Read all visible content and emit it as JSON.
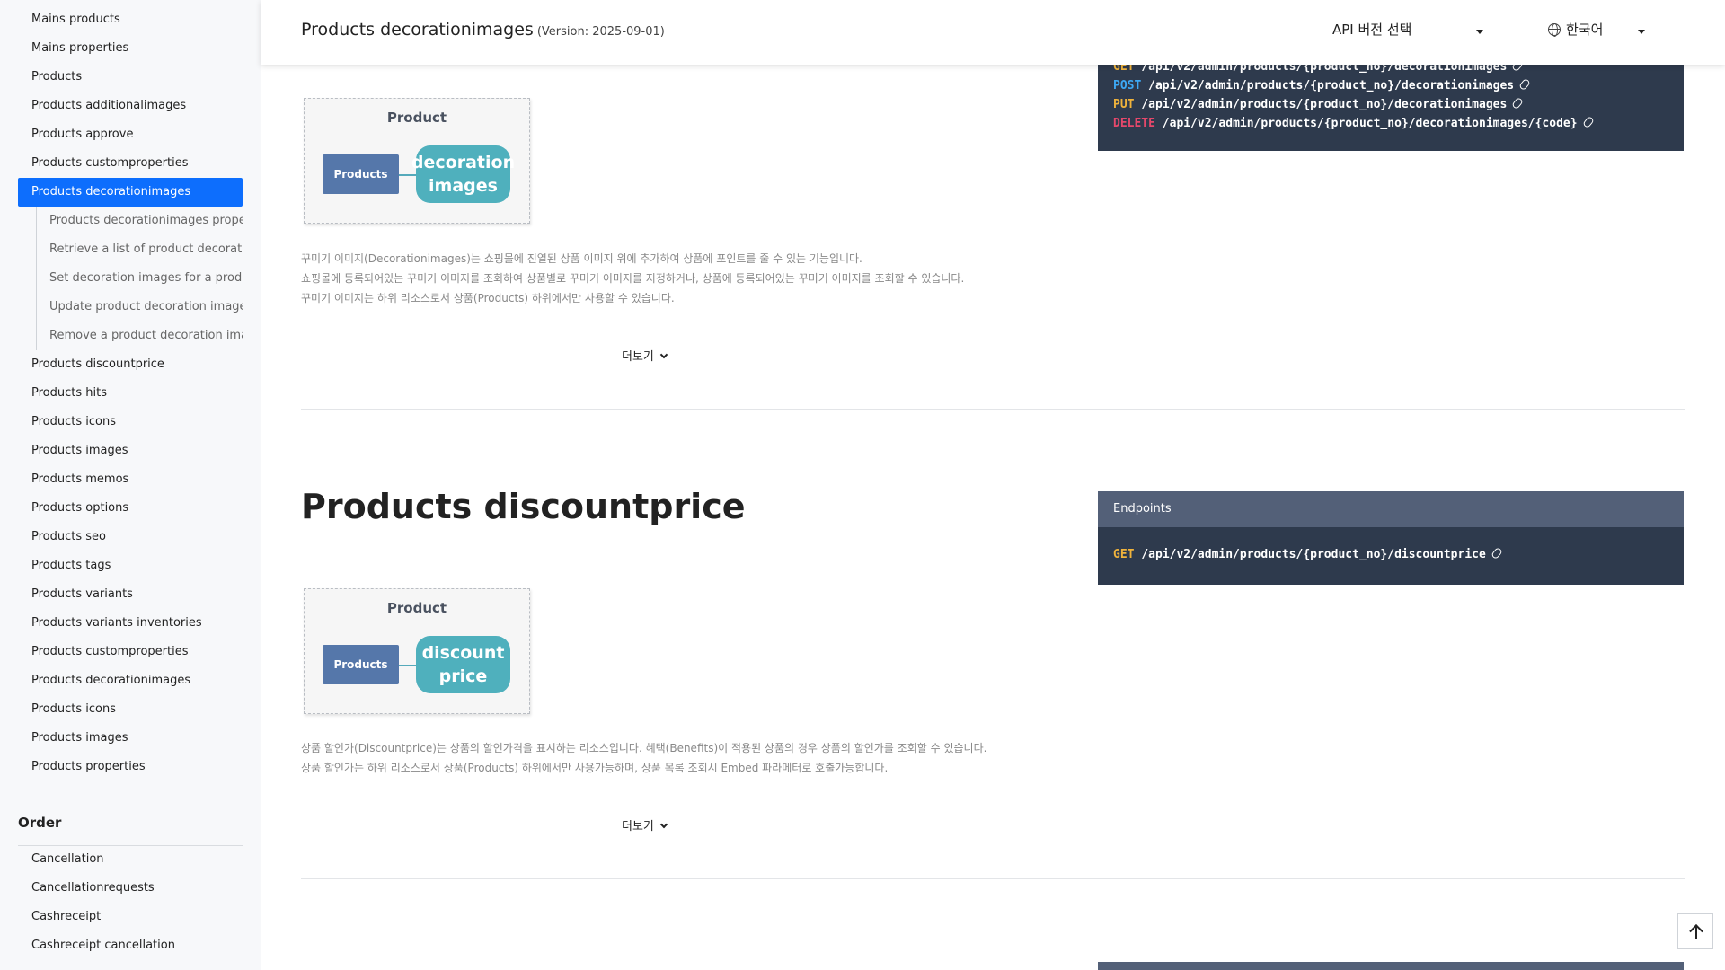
{
  "header": {
    "title": "Products decorationimages",
    "version": "(Version: 2025-09-01)",
    "api_select_label": "API 버전 선택",
    "language_label": "한국어"
  },
  "sidebar": {
    "items_top": [
      {
        "label": "Mains products"
      },
      {
        "label": "Mains properties"
      },
      {
        "label": "Products"
      },
      {
        "label": "Products additionalimages"
      },
      {
        "label": "Products approve"
      },
      {
        "label": "Products customproperties"
      },
      {
        "label": "Products decorationimages",
        "active": true
      }
    ],
    "sub_items": [
      {
        "label": "Products decorationimages property"
      },
      {
        "label": "Retrieve a list of product decoration"
      },
      {
        "label": "Set decoration images for a product"
      },
      {
        "label": "Update product decoration images"
      },
      {
        "label": "Remove a product decoration image"
      }
    ],
    "items_bottom": [
      {
        "label": "Products discountprice"
      },
      {
        "label": "Products hits"
      },
      {
        "label": "Products icons"
      },
      {
        "label": "Products images"
      },
      {
        "label": "Products memos"
      },
      {
        "label": "Products options"
      },
      {
        "label": "Products seo"
      },
      {
        "label": "Products tags"
      },
      {
        "label": "Products variants"
      },
      {
        "label": "Products variants inventories"
      },
      {
        "label": "Products customproperties"
      },
      {
        "label": "Products decorationimages"
      },
      {
        "label": "Products icons"
      },
      {
        "label": "Products images"
      },
      {
        "label": "Products properties"
      }
    ],
    "section_order": "Order",
    "order_items": [
      {
        "label": "Cancellation"
      },
      {
        "label": "Cancellationrequests"
      },
      {
        "label": "Cashreceipt"
      },
      {
        "label": "Cashreceipt cancellation"
      }
    ]
  },
  "section1": {
    "endpoints": [
      {
        "method": "GET",
        "path": "/api/v2/admin/products/{product_no}/decorationimages"
      },
      {
        "method": "POST",
        "path": "/api/v2/admin/products/{product_no}/decorationimages"
      },
      {
        "method": "PUT",
        "path": "/api/v2/admin/products/{product_no}/decorationimages"
      },
      {
        "method": "DELETE",
        "path": "/api/v2/admin/products/{product_no}/decorationimages/{code}"
      }
    ],
    "diagram": {
      "title": "Product",
      "left": "Products",
      "right": "decoration images"
    },
    "desc": [
      "꾸미기 이미지(Decorationimages)는 쇼핑몰에 진열된 상품 이미지 위에 추가하여 상품에 포인트를 줄 수 있는 기능입니다.",
      "쇼핑몰에 등록되어있는 꾸미기 이미지를 조회하여 상품별로 꾸미기 이미지를 지정하거나, 상품에 등록되어있는 꾸미기 이미지를 조회할 수 있습니다.",
      "꾸미기 이미지는 하위 리소스로서 상품(Products) 하위에서만 사용할 수 있습니다."
    ],
    "more_label": "더보기"
  },
  "section2": {
    "title": "Products discountprice",
    "endpoints_label": "Endpoints",
    "endpoints": [
      {
        "method": "GET",
        "path": "/api/v2/admin/products/{product_no}/discountprice"
      }
    ],
    "diagram": {
      "title": "Product",
      "left": "Products",
      "right": "discount price"
    },
    "desc": [
      "상품 할인가(Discountprice)는 상품의 할인가격을 표시하는 리소스입니다. 혜택(Benefits)이 적용된 상품의 경우 상품의 할인가를 조회할 수 있습니다.",
      "상품 할인가는 하위 리소스로서 상품(Products) 하위에서만 사용가능하며, 상품 목록 조회시 Embed 파라메터로 호출가능합니다."
    ],
    "more_label": "더보기"
  },
  "colors": {
    "accent": "#0d6efd",
    "endpoint_bg": "#2e3a4d",
    "endpoint_head": "#536078",
    "get": "#f0b33c",
    "post": "#3da9f5",
    "delete": "#e5486b"
  }
}
